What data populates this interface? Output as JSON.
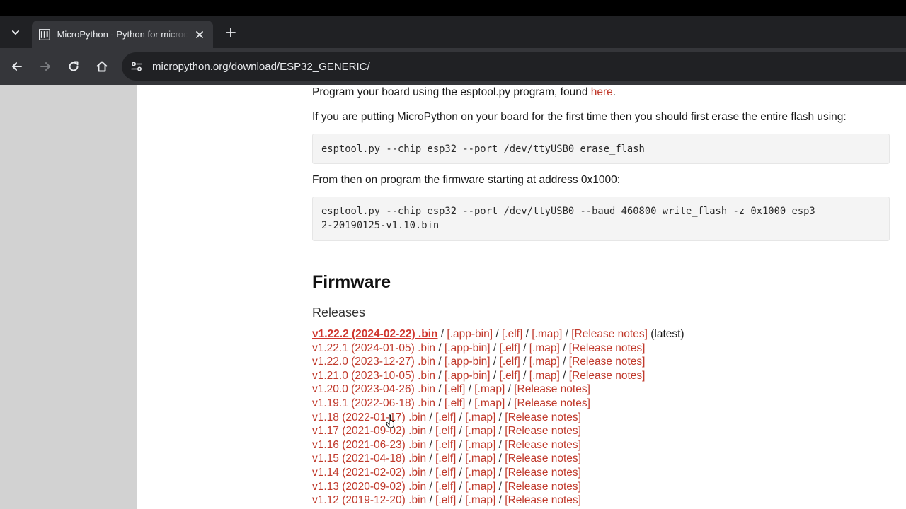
{
  "browser": {
    "tab_title": "MicroPython - Python for microcontrollers",
    "url": "micropython.org/download/ESP32_GENERIC/"
  },
  "page": {
    "program_line_prefix": "Program your board using the esptool.py program, found ",
    "program_line_link": "here",
    "program_line_suffix": ".",
    "erase_intro": "If you are putting MicroPython on your board for the first time then you should first erase the entire flash using:",
    "erase_cmd": "esptool.py --chip esp32 --port /dev/ttyUSB0 erase_flash",
    "program_intro": "From then on program the firmware starting at address 0x1000:",
    "program_cmd_line1": "esptool.py --chip esp32 --port /dev/ttyUSB0 --baud 460800 write_flash -z 0x1000 esp3",
    "program_cmd_line2": "2-20190125-v1.10.bin",
    "firmware_heading": "Firmware",
    "releases_heading": "Releases",
    "latest_label": "(latest)",
    "releases": [
      {
        "main": "v1.22.2 (2024-02-22) .bin",
        "links": [
          "[.app-bin]",
          "[.elf]",
          "[.map]",
          "[Release notes]"
        ],
        "latest": true
      },
      {
        "main": "v1.22.1 (2024-01-05) .bin",
        "links": [
          "[.app-bin]",
          "[.elf]",
          "[.map]",
          "[Release notes]"
        ]
      },
      {
        "main": "v1.22.0 (2023-12-27) .bin",
        "links": [
          "[.app-bin]",
          "[.elf]",
          "[.map]",
          "[Release notes]"
        ]
      },
      {
        "main": "v1.21.0 (2023-10-05) .bin",
        "links": [
          "[.app-bin]",
          "[.elf]",
          "[.map]",
          "[Release notes]"
        ]
      },
      {
        "main": "v1.20.0 (2023-04-26) .bin",
        "links": [
          "[.elf]",
          "[.map]",
          "[Release notes]"
        ]
      },
      {
        "main": "v1.19.1 (2022-06-18) .bin",
        "links": [
          "[.elf]",
          "[.map]",
          "[Release notes]"
        ]
      },
      {
        "main": "v1.18 (2022-01-17) .bin",
        "links": [
          "[.elf]",
          "[.map]",
          "[Release notes]"
        ]
      },
      {
        "main": "v1.17 (2021-09-02) .bin",
        "links": [
          "[.elf]",
          "[.map]",
          "[Release notes]"
        ]
      },
      {
        "main": "v1.16 (2021-06-23) .bin",
        "links": [
          "[.elf]",
          "[.map]",
          "[Release notes]"
        ]
      },
      {
        "main": "v1.15 (2021-04-18) .bin",
        "links": [
          "[.elf]",
          "[.map]",
          "[Release notes]"
        ]
      },
      {
        "main": "v1.14 (2021-02-02) .bin",
        "links": [
          "[.elf]",
          "[.map]",
          "[Release notes]"
        ]
      },
      {
        "main": "v1.13 (2020-09-02) .bin",
        "links": [
          "[.elf]",
          "[.map]",
          "[Release notes]"
        ]
      },
      {
        "main": "v1.12 (2019-12-20) .bin",
        "links": [
          "[.elf]",
          "[.map]",
          "[Release notes]"
        ]
      }
    ]
  },
  "colors": {
    "link": "#c0392b",
    "chrome_dark": "#202124",
    "chrome_toolbar": "#35363a",
    "side_panel": "#d2d2d2"
  },
  "icons": {
    "tab_list": "chevron-down-icon",
    "favicon": "micropython-logo-icon",
    "tab_close": "close-icon",
    "new_tab": "plus-icon",
    "back": "arrow-left-icon",
    "forward": "arrow-right-icon",
    "reload": "reload-icon",
    "home": "home-icon",
    "site_info": "site-settings-icon"
  }
}
